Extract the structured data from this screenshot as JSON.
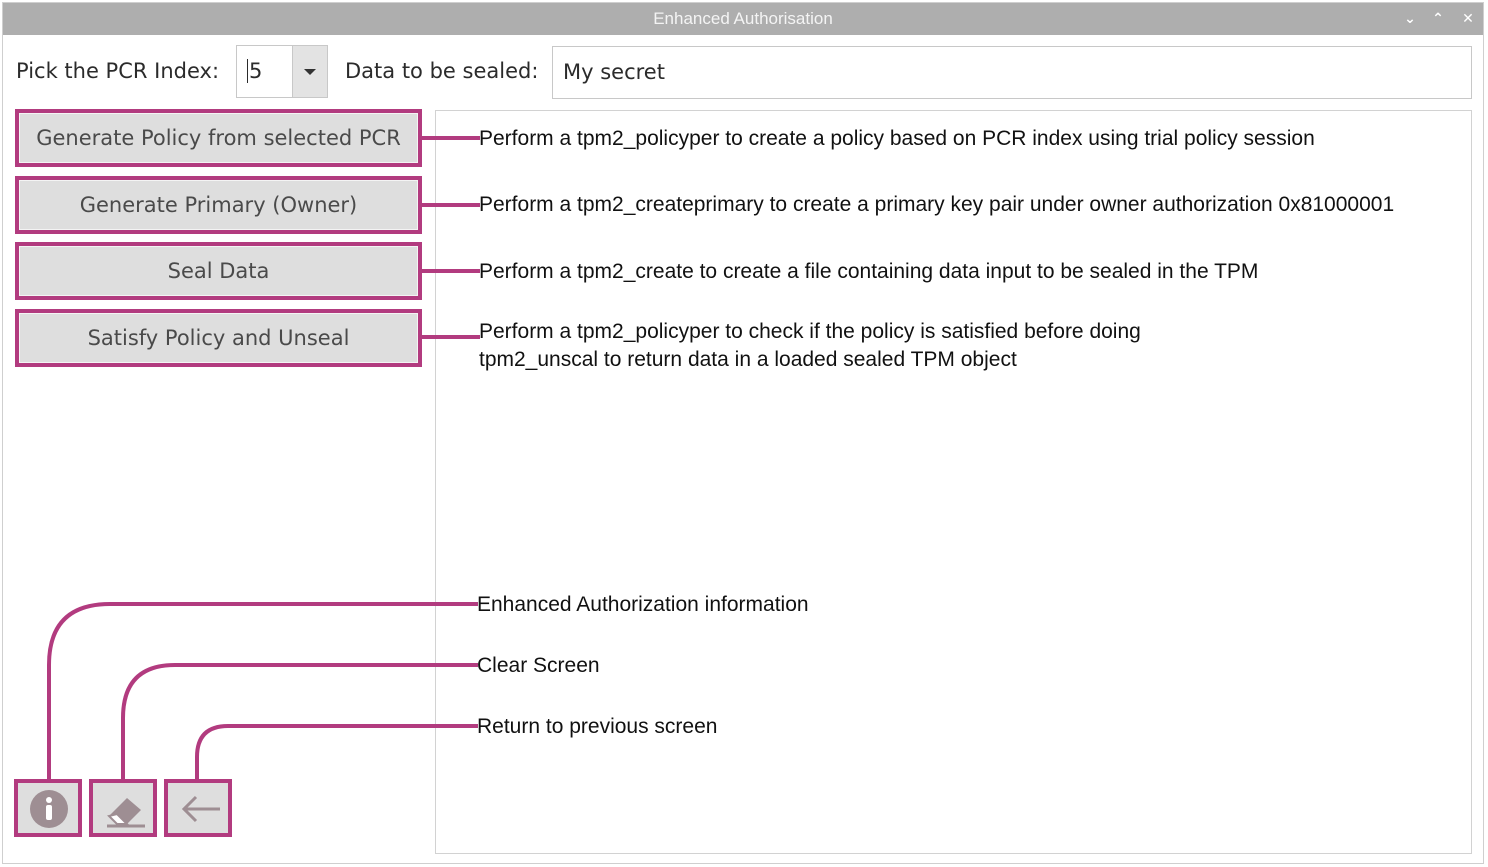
{
  "window": {
    "title": "Enhanced Authorisation",
    "controls": {
      "minimize": "⌄",
      "maximize": "⌃",
      "close": "✕"
    }
  },
  "form": {
    "pcr_label": "Pick the PCR Index:",
    "pcr_value": "5",
    "data_label": "Data to be sealed:",
    "data_value": "My secret"
  },
  "buttons": [
    {
      "label": "Generate Policy from selected PCR"
    },
    {
      "label": "Generate Primary (Owner)"
    },
    {
      "label": "Seal Data"
    },
    {
      "label": "Satisfy Policy and Unseal"
    }
  ],
  "annotations": {
    "policy": "Perform a tpm2_policyper to create a policy based on PCR index using trial policy session",
    "primary": "Perform a tpm2_createprimary to create a primary key pair under owner authorization 0x81000001",
    "seal": "Perform a tpm2_create to create a file containing data input to be sealed in the TPM",
    "unseal_line1": "Perform a tpm2_policyper to check if the policy is satisfied before doing",
    "unseal_line2": "tpm2_unscal to return data in a loaded sealed TPM object",
    "info": "Enhanced Authorization information",
    "clear": "Clear Screen",
    "back": "Return to previous screen"
  },
  "icons": {
    "info": "info-icon",
    "clear": "eraser-icon",
    "back": "arrow-left-icon"
  },
  "colors": {
    "highlight": "#b23b7f",
    "titlebar": "#aeaeae",
    "button_face": "#dedede",
    "icon": "#9e8e93"
  }
}
